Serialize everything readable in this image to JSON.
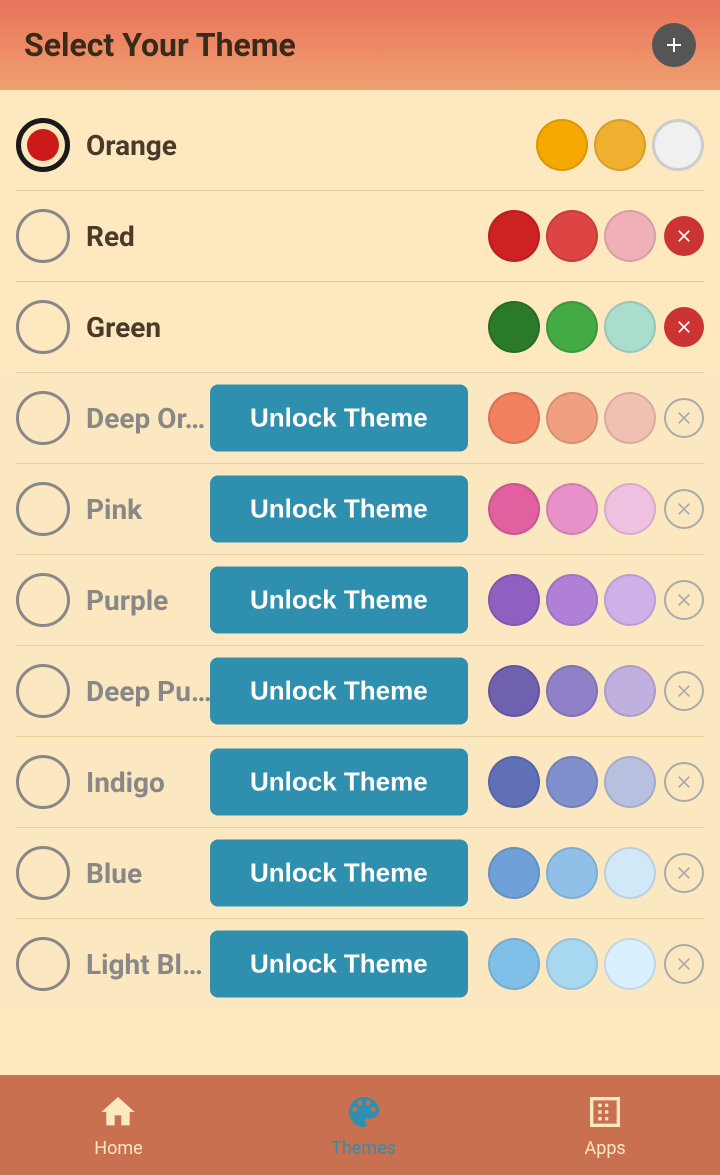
{
  "header": {
    "title": "Select Your Theme",
    "add_button_label": "+"
  },
  "themes": [
    {
      "id": "orange",
      "name": "Orange",
      "locked": false,
      "selected": true,
      "swatches": [
        "#f5a800",
        "#f0b030",
        "#f0f0f0"
      ],
      "swatch_types": [
        "solid",
        "solid",
        "white"
      ],
      "show_remove": false
    },
    {
      "id": "red",
      "name": "Red",
      "locked": false,
      "selected": false,
      "swatches": [
        "#cc2222",
        "#dd4444",
        "#f0b0b8"
      ],
      "swatch_types": [
        "solid",
        "solid",
        "solid"
      ],
      "show_remove": true
    },
    {
      "id": "green",
      "name": "Green",
      "locked": false,
      "selected": false,
      "swatches": [
        "#2a7a2a",
        "#44aa44",
        "#aaddcc"
      ],
      "swatch_types": [
        "solid",
        "solid",
        "solid"
      ],
      "show_remove": true
    },
    {
      "id": "deep-orange",
      "name": "Deep Orange",
      "locked": true,
      "selected": false,
      "swatches": [
        "#f08060",
        "#f0a080",
        "#f0c0b0"
      ],
      "swatch_types": [
        "solid",
        "solid",
        "solid"
      ],
      "show_remove": true,
      "unlock_label": "Unlock Theme"
    },
    {
      "id": "pink",
      "name": "Pink",
      "locked": true,
      "selected": false,
      "swatches": [
        "#e060a0",
        "#e890c8",
        "#f0c0e0"
      ],
      "swatch_types": [
        "solid",
        "solid",
        "solid"
      ],
      "show_remove": true,
      "unlock_label": "Unlock Theme"
    },
    {
      "id": "purple",
      "name": "Purple",
      "locked": true,
      "selected": false,
      "swatches": [
        "#9060c0",
        "#b080d8",
        "#d0b0e8"
      ],
      "swatch_types": [
        "solid",
        "solid",
        "solid"
      ],
      "show_remove": true,
      "unlock_label": "Unlock Theme"
    },
    {
      "id": "deep-purple",
      "name": "Deep Purple",
      "locked": true,
      "selected": false,
      "swatches": [
        "#7060b0",
        "#9080c8",
        "#c0b0e0"
      ],
      "swatch_types": [
        "solid",
        "solid",
        "solid"
      ],
      "show_remove": true,
      "unlock_label": "Unlock Theme"
    },
    {
      "id": "indigo",
      "name": "Indigo",
      "locked": true,
      "selected": false,
      "swatches": [
        "#6070b8",
        "#8090cc",
        "#b8c0e0"
      ],
      "swatch_types": [
        "solid",
        "solid",
        "solid"
      ],
      "show_remove": true,
      "unlock_label": "Unlock Theme"
    },
    {
      "id": "blue",
      "name": "Blue",
      "locked": true,
      "selected": false,
      "swatches": [
        "#70a0d8",
        "#90c0e8",
        "#d0e8f8"
      ],
      "swatch_types": [
        "solid",
        "solid",
        "solid"
      ],
      "show_remove": true,
      "unlock_label": "Unlock Theme"
    },
    {
      "id": "light-blue",
      "name": "Light Blue",
      "locked": true,
      "selected": false,
      "swatches": [
        "#80c0e8",
        "#a8d8f0",
        "#d8f0ff"
      ],
      "swatch_types": [
        "solid",
        "solid",
        "solid"
      ],
      "show_remove": true,
      "unlock_label": "Unlock Theme"
    }
  ],
  "nav": {
    "items": [
      {
        "id": "home",
        "label": "Home",
        "active": false
      },
      {
        "id": "themes",
        "label": "Themes",
        "active": true
      },
      {
        "id": "apps",
        "label": "Apps",
        "active": false
      }
    ]
  }
}
